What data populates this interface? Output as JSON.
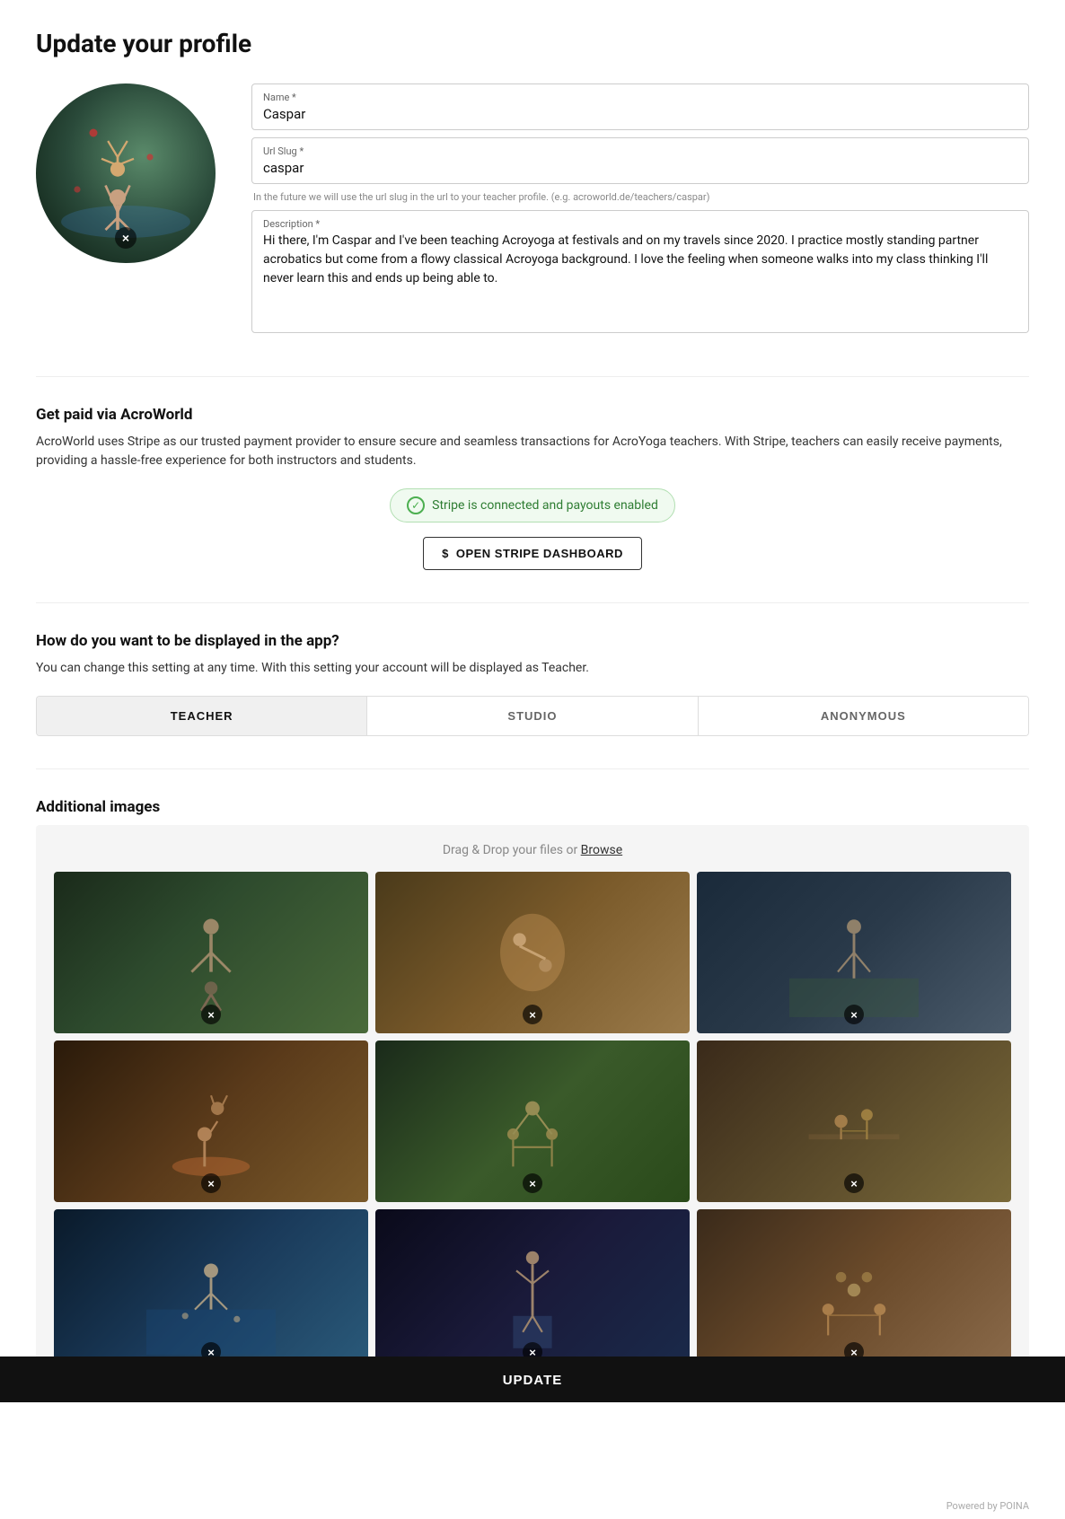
{
  "page": {
    "title": "Update your profile"
  },
  "profile": {
    "name_label": "Name *",
    "name_value": "Caspar",
    "url_slug_label": "Url Slug *",
    "url_slug_value": "caspar",
    "url_slug_hint": "In the future we will use the url slug in the url to your teacher profile. (e.g. acroworld.de/teachers/caspar)",
    "description_label": "Description *",
    "description_value": "Hi there, I'm Caspar and I've been teaching Acroyoga at festivals and on my travels since 2020. I practice mostly standing partner acrobatics but come from a flowy classical Acroyoga background. I love the feeling when someone walks into my class thinking I'll never learn this and ends up being able to."
  },
  "payment": {
    "section_title": "Get paid via AcroWorld",
    "section_desc": "AcroWorld uses Stripe as our trusted payment provider to ensure secure and seamless transactions for AcroYoga teachers. With Stripe, teachers can easily receive payments, providing a hassle-free experience for both instructors and students.",
    "stripe_status": "Stripe is connected and payouts enabled",
    "stripe_dashboard_btn": "OPEN STRIPE DASHBOARD"
  },
  "display": {
    "section_title": "How do you want to be displayed in the app?",
    "section_desc": "You can change this setting at any time. With this setting your account will be displayed as Teacher.",
    "tabs": [
      {
        "id": "teacher",
        "label": "TEACHER",
        "active": true
      },
      {
        "id": "studio",
        "label": "STUDIO",
        "active": false
      },
      {
        "id": "anonymous",
        "label": "ANONYMOUS",
        "active": false
      }
    ]
  },
  "images": {
    "section_title": "Additional images",
    "dropzone_hint": "Drag & Drop your files or",
    "browse_label": "Browse",
    "items": [
      {
        "id": 1,
        "class": "img-1"
      },
      {
        "id": 2,
        "class": "img-2"
      },
      {
        "id": 3,
        "class": "img-3"
      },
      {
        "id": 4,
        "class": "img-4"
      },
      {
        "id": 5,
        "class": "img-5"
      },
      {
        "id": 6,
        "class": "img-6"
      },
      {
        "id": 7,
        "class": "img-7"
      },
      {
        "id": 8,
        "class": "img-8"
      },
      {
        "id": 9,
        "class": "img-9"
      }
    ]
  },
  "footer": {
    "powered_by": "Powered by POINA",
    "update_btn": "UPDATE"
  },
  "icons": {
    "check": "✓",
    "dollar": "$",
    "close": "×"
  }
}
